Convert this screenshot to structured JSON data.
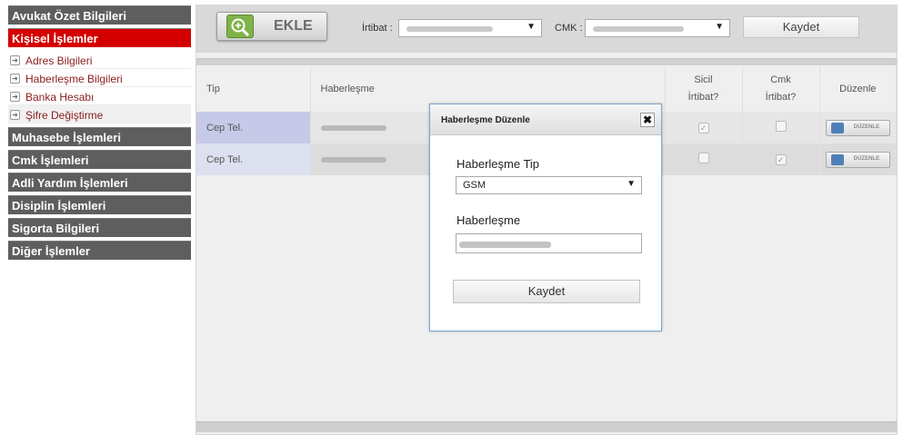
{
  "sidebar": {
    "sections": [
      {
        "label": "Avukat Özet Bilgileri"
      },
      {
        "label": "Kişisel İşlemler"
      }
    ],
    "sub_items": [
      {
        "label": "Adres Bilgileri"
      },
      {
        "label": "Haberleşme Bilgileri"
      },
      {
        "label": "Banka Hesabı"
      },
      {
        "label": "Şifre Değiştirme"
      }
    ],
    "more_sections": [
      {
        "label": "Muhasebe İşlemleri"
      },
      {
        "label": "Cmk İşlemleri"
      },
      {
        "label": "Adli Yardım İşlemleri"
      },
      {
        "label": "Disiplin İşlemleri"
      },
      {
        "label": "Sigorta Bilgileri"
      },
      {
        "label": "Diğer İşlemler"
      }
    ]
  },
  "toolbar": {
    "add_label": "EKLE",
    "irtibat_label": "İrtibat :",
    "cmk_label": "CMK :",
    "save_label": "Kaydet"
  },
  "table": {
    "columns": {
      "tip": "Tip",
      "haberlesme": "Haberleşme",
      "sicil_1": "Sicil",
      "sicil_2": "İrtibat?",
      "cmk_1": "Cmk",
      "cmk_2": "İrtibat?",
      "duzenle": "Düzenle"
    },
    "rows": [
      {
        "tip": "Cep Tel.",
        "sicil_irtibat": true,
        "cmk_irtibat": false,
        "edit_label": "DÜZENLE"
      },
      {
        "tip": "Cep Tel.",
        "sicil_irtibat": false,
        "cmk_irtibat": true,
        "edit_label": "DÜZENLE"
      }
    ]
  },
  "modal": {
    "title": "Haberleşme Düzenle",
    "type_label": "Haberleşme Tip",
    "type_value": "GSM",
    "value_label": "Haberleşme",
    "save_label": "Kaydet"
  },
  "colors": {
    "active_section": "#d40000",
    "section_bg": "#5e5e5e",
    "modal_border": "#7aa6d6"
  }
}
